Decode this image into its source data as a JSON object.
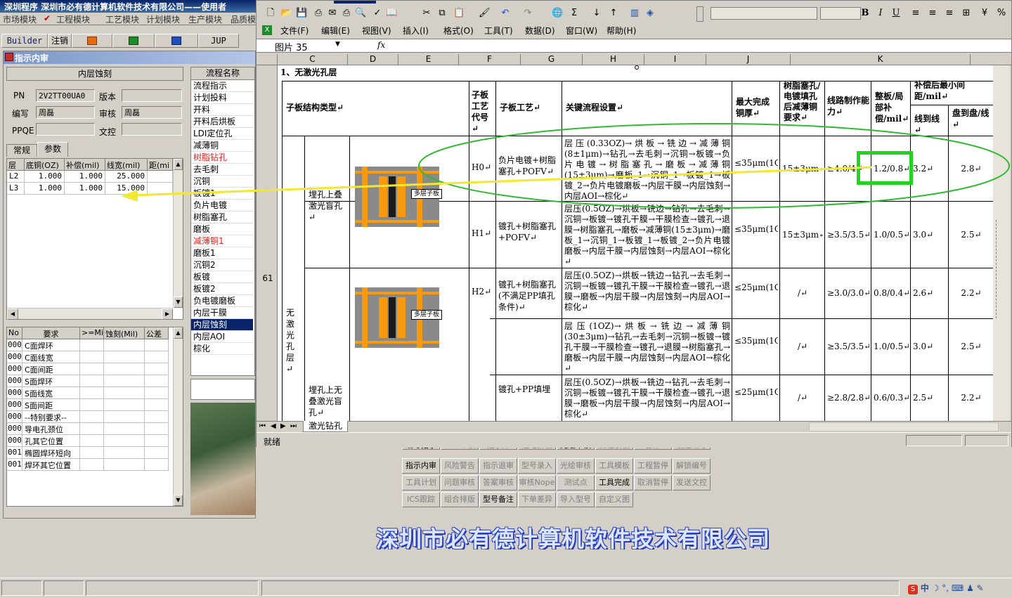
{
  "erp": {
    "title": "深圳程序   深圳市必有德计算机软件技术有限公司——使用者",
    "menu": [
      "市场模块",
      "工程模块",
      "工艺模块",
      "计划模块",
      "生产模块",
      "品质模"
    ],
    "toolbar": [
      "Builder",
      "注销",
      "",
      "",
      "",
      "JUP"
    ],
    "window_title": "指示内审",
    "header_box": "内层蚀刻",
    "fields": {
      "pn_label": "PN",
      "pn": "2V2TT00UA0",
      "ver_label": "版本",
      "ver": "",
      "writer_label": "编写",
      "writer": "周磊",
      "review_label": "审核",
      "review": "周磊",
      "ppqe_label": "PPQE",
      "ppqe": "",
      "doc_label": "文控",
      "doc": ""
    },
    "tabs": [
      "常规",
      "参数"
    ],
    "layer_grid": {
      "headers": [
        "层",
        "底铜(OZ)",
        "补偿(mil)",
        "线宽(mil)",
        "距(mi"
      ],
      "rows": [
        [
          "L2",
          "1.000",
          "1.000",
          "25.000",
          ""
        ],
        [
          "L3",
          "1.000",
          "1.000",
          "15.000",
          ""
        ]
      ]
    },
    "req_grid": {
      "headers": [
        "No",
        "要求",
        ">=Mil",
        "蚀刻(Mil)",
        "公差"
      ],
      "rows": [
        [
          "000",
          "C面焊环"
        ],
        [
          "000",
          "C面线宽"
        ],
        [
          "000",
          "C面间距"
        ],
        [
          "000",
          "S面焊环"
        ],
        [
          "000",
          "S面线宽"
        ],
        [
          "000",
          "S面间距"
        ],
        [
          "000",
          "--特别要求--"
        ],
        [
          "000",
          "导电孔颈位"
        ],
        [
          "000",
          "孔其它位置"
        ],
        [
          "001",
          "椭圆焊环短向"
        ],
        [
          "001",
          "焊环其它位置"
        ]
      ]
    },
    "flow_header": "流程名称",
    "flow": [
      {
        "t": "流程指示",
        "red": false
      },
      {
        "t": "计划投料",
        "red": false
      },
      {
        "t": "开料",
        "red": false
      },
      {
        "t": "开料后烘板",
        "red": false
      },
      {
        "t": "LDI定位孔",
        "red": false
      },
      {
        "t": "减薄铜",
        "red": false
      },
      {
        "t": "树脂钻孔",
        "red": true
      },
      {
        "t": "去毛刺",
        "red": false
      },
      {
        "t": "沉铜",
        "red": false
      },
      {
        "t": "板镀1",
        "red": false
      },
      {
        "t": "负片电镀",
        "red": false
      },
      {
        "t": "树脂塞孔",
        "red": false
      },
      {
        "t": "磨板",
        "red": false
      },
      {
        "t": "减薄铜1",
        "red": true
      },
      {
        "t": "磨板1",
        "red": false
      },
      {
        "t": "沉铜2",
        "red": false
      },
      {
        "t": "板镀",
        "red": false
      },
      {
        "t": "板镀2",
        "red": false
      },
      {
        "t": "负电镀磨板",
        "red": false
      },
      {
        "t": "内层干膜",
        "red": false
      },
      {
        "t": "内层蚀刻",
        "red": false
      },
      {
        "t": "内层AOI",
        "red": false
      },
      {
        "t": "棕化",
        "red": false
      }
    ],
    "btn_rows": [
      [
        {
          "t": "编写指示",
          "on": true
        },
        {
          "t": "ECN审核",
          "on": false
        },
        {
          "t": "指示库",
          "on": false
        },
        {
          "t": "阻电拼板",
          "on": false
        },
        {
          "t": "光绘审核",
          "on": true
        },
        {
          "t": "流程模板",
          "on": false
        },
        {
          "t": "暂停",
          "on": false
        },
        {
          "t": "被迫编号",
          "on": false
        }
      ],
      [
        {
          "t": "指示内审",
          "on": true
        },
        {
          "t": "风险警告",
          "on": false
        },
        {
          "t": "指示退审",
          "on": false
        },
        {
          "t": "型号录入",
          "on": false
        },
        {
          "t": "光绘审核",
          "on": false
        },
        {
          "t": "工具模板",
          "on": false
        },
        {
          "t": "工程暂停",
          "on": false
        },
        {
          "t": "解锁编号",
          "on": false
        }
      ],
      [
        {
          "t": "工具计划",
          "on": false
        },
        {
          "t": "问题审核",
          "on": false
        },
        {
          "t": "答案审核",
          "on": false
        },
        {
          "t": "审核Nope",
          "on": false
        },
        {
          "t": "测试点",
          "on": false
        },
        {
          "t": "工具完成",
          "on": true
        },
        {
          "t": "取消暂停",
          "on": false
        },
        {
          "t": "发送文控",
          "on": false
        }
      ],
      [
        {
          "t": "ICS跟踪",
          "on": false
        },
        {
          "t": "组合排版",
          "on": false
        },
        {
          "t": "型号备注",
          "on": true
        },
        {
          "t": "下单差异",
          "on": false
        },
        {
          "t": "导入型号",
          "on": false
        },
        {
          "t": "自定义图",
          "on": false
        }
      ]
    ],
    "company": "深圳市必有德计算机软件技术有限公司"
  },
  "excel": {
    "menu": [
      "文件(F)",
      "编辑(E)",
      "视图(V)",
      "插入(I)",
      "格式(O)",
      "工具(T)",
      "数据(D)",
      "窗口(W)",
      "帮助(H)"
    ],
    "namebox": "图片 35",
    "fx": "fx",
    "columns": [
      "C",
      "D",
      "E",
      "F",
      "G",
      "H",
      "I",
      "J",
      "K"
    ],
    "row_number": "61",
    "section_title": "1、无激光孔层",
    "headers": {
      "struct": "子板结构类型↵",
      "code": "子板工艺代号↵",
      "process": "子板工艺↵",
      "flow": "关键流程设置↵",
      "max_cu": "最大完成铜厚↵",
      "resin": "树脂塞孔/电镀填孔后减薄铜要求↵",
      "line": "线路制作能力↵",
      "comp": "整板/局部补偿/mil↵",
      "min_space": "补偿后最小间距/mil↵",
      "line_line": "线到线↵",
      "pad_line": "盘到盘/线↵"
    },
    "left_label": "无激光孔层↵",
    "group1": "埋孔上叠激光盲孔↵",
    "group2": "埋孔上无叠激光盲孔↵",
    "pcb_label": "多层子板",
    "rows": [
      {
        "code": "H0↵",
        "proc": "负片电镀+树脂塞孔+POFV↵",
        "flow": "层压(0.33OZ)→烘板→铣边→减薄铜(8±1μm)→钻孔→去毛刺→沉铜→板镀→负片电镀→树脂塞孔→磨板→减薄铜(15±3μm)→磨板_1→沉铜_1→板镀_1→板镀_2→负片电镀磨板→内层干膜→内层蚀刻→内层AOI→棕化↵",
        "cu": "≤35μm(1OZ)↵",
        "resin": "15±3μm↵",
        "line": "≥4.0/4↵",
        "comp": "1.2/0.8↵",
        "ll": "3.2↵",
        "pl": "2.8↵"
      },
      {
        "code": "H1↵",
        "proc": "镀孔+树脂塞孔+POFV↵",
        "flow": "层压(0.5OZ)→烘板→铣边→钻孔→去毛刺→沉铜→板镀→镀孔干膜→干膜检查→镀孔→退膜→树脂塞孔→磨板→减薄铜(15±3μm)→磨板_1→沉铜_1→板镀_1→板镀_2→负片电镀磨板→内层干膜→内层蚀刻→内层AOI→棕化↵",
        "cu": "≤35μm(1OZ)↵",
        "resin": "15±3μm↵",
        "line": "≥3.5/3.5↵",
        "comp": "1.0/0.5↵",
        "ll": "3.0↵",
        "pl": "2.5↵"
      },
      {
        "code": "H2↵",
        "proc": "镀孔+树脂塞孔(不满足PP填孔条件)↵",
        "flow": "层压(0.5OZ)→烘板→铣边→钻孔→去毛刺→沉铜→板镀→镀孔干膜→干膜检查→镀孔→退膜→磨板→内层干膜→内层蚀刻→内层AOI→棕化↵",
        "cu": "≤25μm(1OZ)↵",
        "resin": "/↵",
        "line": "≥3.0/3.0↵",
        "comp": "0.8/0.4↵",
        "ll": "2.6↵",
        "pl": "2.2↵"
      },
      {
        "code": "",
        "proc": "",
        "flow": "层压(1OZ)→烘板→铣边→减薄铜(30±3μm)→钻孔→去毛刺→沉铜→板镀→镀孔干膜→干膜检查→镀孔→退膜→树脂塞孔→磨板→内层干膜→内层蚀刻→内层AOI→棕化↵",
        "cu": "≤35μm(1OZ)↵",
        "resin": "/↵",
        "line": "≥3.5/3.5↵",
        "comp": "1.0/0.5↵",
        "ll": "3.0↵",
        "pl": "2.5↵"
      },
      {
        "code": "",
        "proc": "镀孔+PP填埋",
        "flow": "层压(0.5OZ)→烘板→铣边→钻孔→去毛刺→沉铜→板镀→镀孔干膜→干膜检查→镀孔→退膜→磨板→内层干膜→内层蚀刻→内层AOI→棕化↵",
        "cu": "≤25μm(1OZ)↵",
        "resin": "/↵",
        "line": "≥2.8/2.8↵",
        "comp": "0.6/0.3↵",
        "ll": "2.5↵",
        "pl": "2.2↵"
      }
    ],
    "sheet_tab": "激光钻孔",
    "status": "就绪"
  },
  "colors": {
    "highlight": "#22d422",
    "ellipse": "#2fba2f",
    "arrow": "#f2e830",
    "title_blue": "#0a246a"
  }
}
